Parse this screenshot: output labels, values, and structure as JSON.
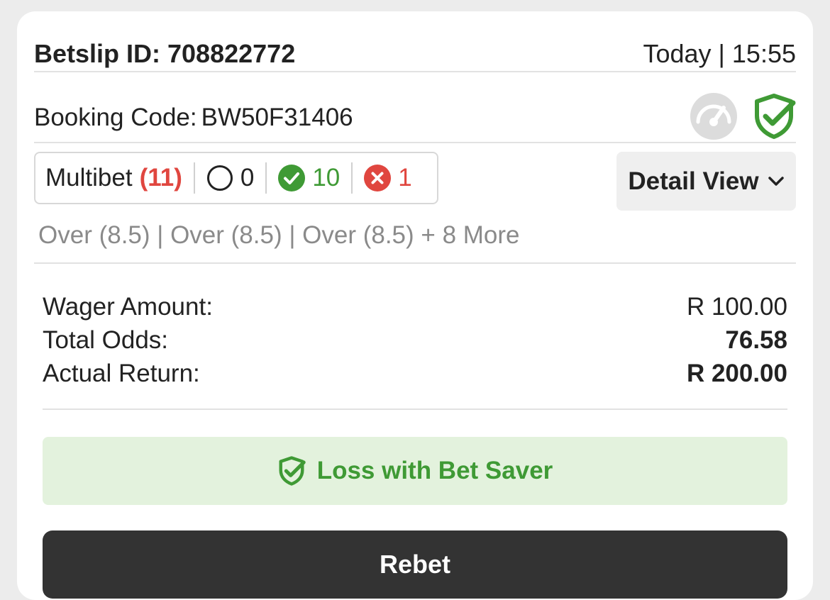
{
  "header": {
    "betslip_label": "Betslip ID:",
    "betslip_id": "708822772",
    "datetime": "Today | 15:55"
  },
  "booking": {
    "label": "Booking Code:",
    "code": "BW50F31406",
    "icons": [
      "speedometer-icon",
      "shield-check-icon"
    ]
  },
  "multibet": {
    "label": "Multibet",
    "count": "(11)",
    "pending": "0",
    "won": "10",
    "lost": "1"
  },
  "detail_view": {
    "label": "Detail View"
  },
  "selections_summary": "Over (8.5) | Over (8.5) | Over (8.5) + 8 More",
  "summary": {
    "wager_label": "Wager Amount:",
    "wager_value": "R 100.00",
    "odds_label": "Total Odds:",
    "odds_value": "76.58",
    "return_label": "Actual Return:",
    "return_value": "R 200.00"
  },
  "result": {
    "label": "Loss with Bet Saver"
  },
  "rebet": {
    "label": "Rebet"
  },
  "colors": {
    "won": "#3f9a35",
    "lost": "#e0463f",
    "banner_bg": "#e3f2dd",
    "rebet_bg": "#333333"
  }
}
